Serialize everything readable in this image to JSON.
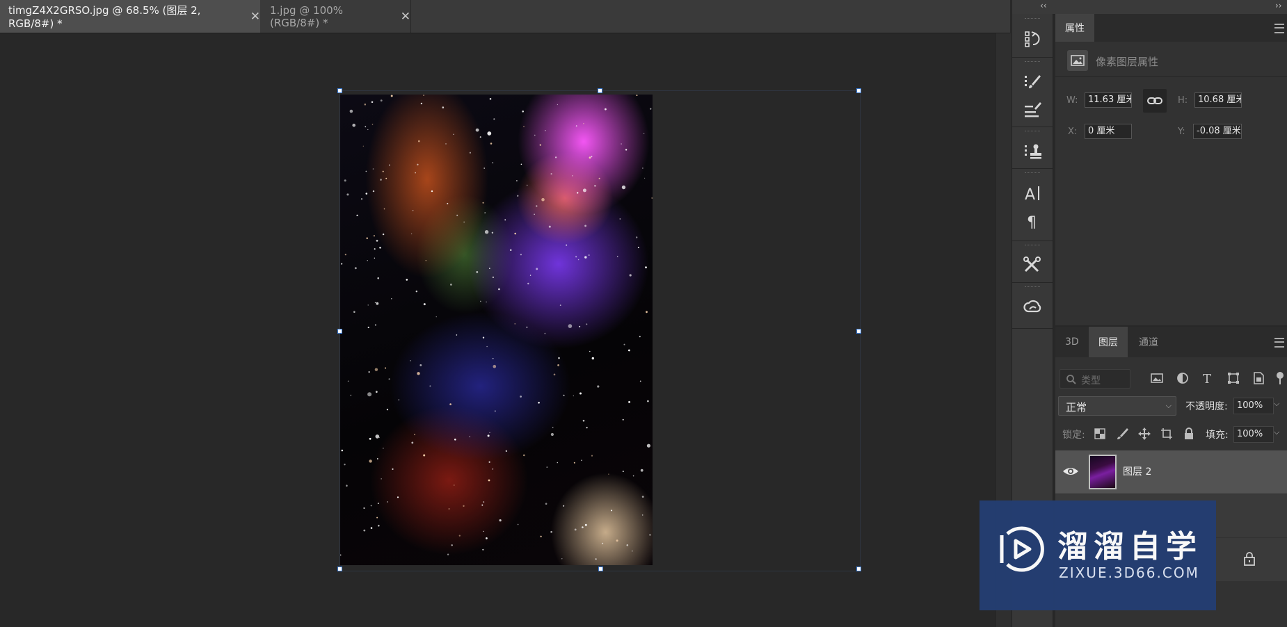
{
  "tabs": [
    {
      "label": "timgZ4X2GRSO.jpg @ 68.5% (图层 2, RGB/8#) *",
      "close": "✕",
      "active": true
    },
    {
      "label": "1.jpg @ 100%(RGB/8#) *",
      "close": "✕",
      "active": false
    }
  ],
  "collapse": {
    "left": "‹‹",
    "right": "››"
  },
  "toolstrip": {
    "icons": [
      "history-icon",
      "brush-settings-icon",
      "brush-presets-icon",
      "clone-source-icon",
      "character-icon",
      "paragraph-icon",
      "tool-presets-icon",
      "creative-cloud-libraries-icon"
    ]
  },
  "properties": {
    "tab": "属性",
    "title": "像素图层属性",
    "w_label": "W:",
    "w_value": "11.63 厘米",
    "h_label": "H:",
    "h_value": "10.68 厘米",
    "x_label": "X:",
    "x_value": "0 厘米",
    "y_label": "Y:",
    "y_value": "-0.08 厘米"
  },
  "layers_panel": {
    "tabs": [
      "3D",
      "图层",
      "通道"
    ],
    "active_tab": "图层",
    "filter_kind": "类型",
    "blend_mode": "正常",
    "opacity_label": "不透明度:",
    "opacity_value": "100%",
    "lock_label": "锁定:",
    "fill_label": "填充:",
    "fill_value": "100%",
    "layers": [
      {
        "name": "图层 2",
        "visible": true,
        "selected": true
      }
    ]
  },
  "watermark": {
    "title": "溜溜自学",
    "url": "ZIXUE.3D66.COM"
  },
  "colors": {
    "accent_handle": "#3a7bd5",
    "watermark_bg": "#243e72",
    "panel_bg": "#323232"
  }
}
